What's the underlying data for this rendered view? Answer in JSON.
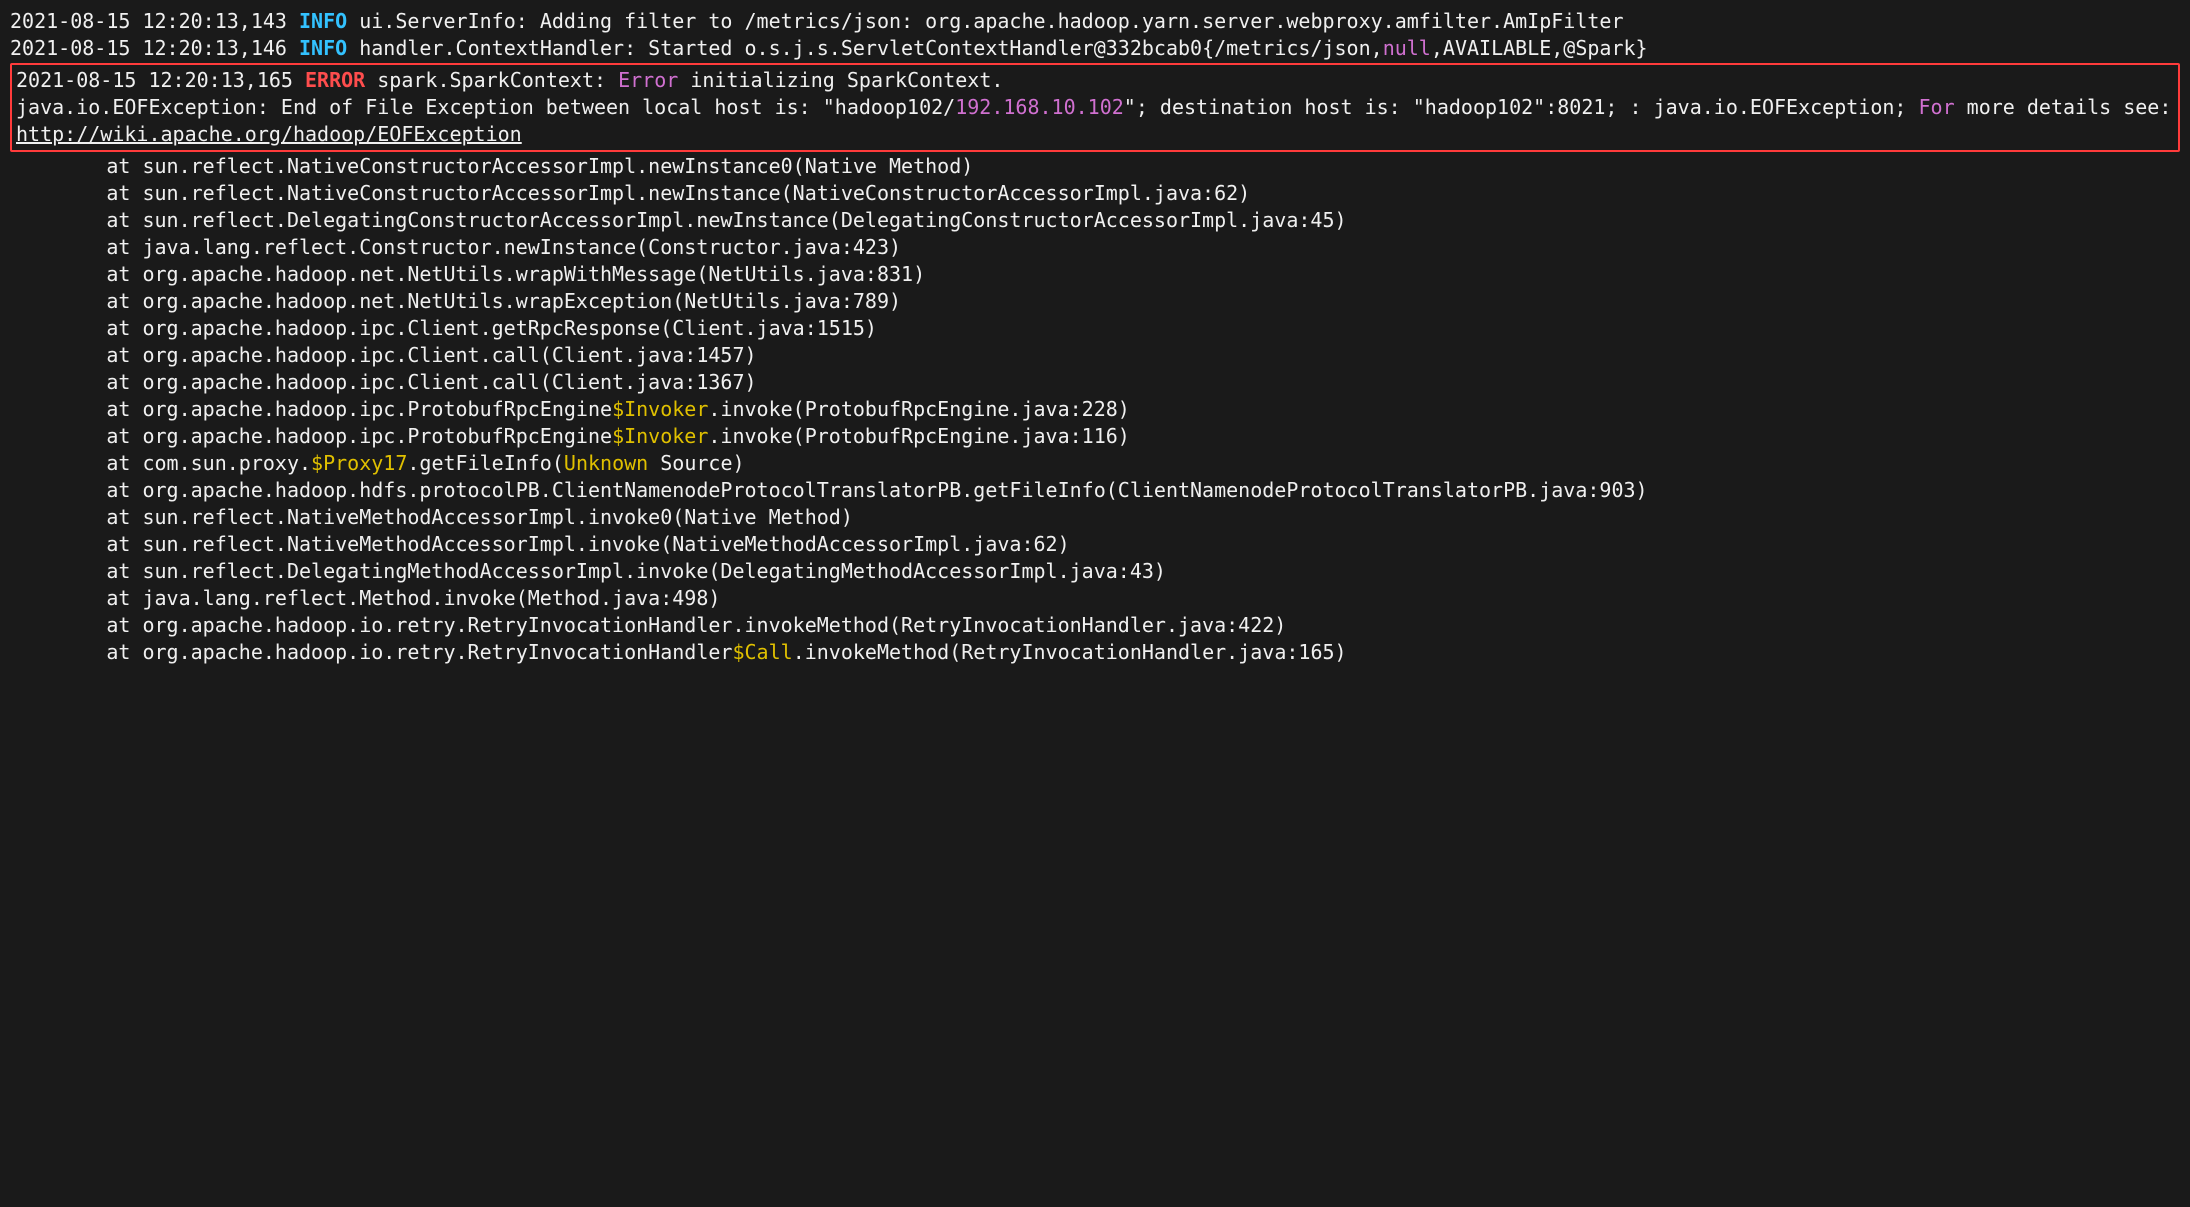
{
  "colors": {
    "info": "#33c2ff",
    "error": "#ff4d4d",
    "pink": "#d070d0",
    "yellow": "#e0c000",
    "hl_border": "#ff3b3b",
    "background": "#1a1a1a",
    "text": "#f0f0f0"
  },
  "log": {
    "l1_ts": "2021-08-15 12:20:13,143 ",
    "l1_level": "INFO",
    "l1_rest": " ui.ServerInfo: Adding filter to /metrics/json: org.apache.hadoop.yarn.server.webproxy.amfilter.AmIpFilter",
    "l2_ts": "2021-08-15 12:20:13,146 ",
    "l2_level": "INFO",
    "l2_a": " handler.ContextHandler: Started o.s.j.s.ServletContextHandler@332bcab0{/metrics/json,",
    "l2_null": "null",
    "l2_b": ",AVAILABLE,@Spark}",
    "hl_ts": "2021-08-15 12:20:13,165 ",
    "hl_level": "ERROR",
    "hl_a": " spark.SparkContext: ",
    "hl_err": "Error",
    "hl_b": " initializing SparkContext.\njava.io.EOFException: End of File Exception between local host is: \"hadoop102/",
    "hl_ip": "192.168.10.102",
    "hl_c": "\"; destination host is: \"hadoop102\":8021; : java.io.EOFException; ",
    "hl_for": "For",
    "hl_d": " more details see:  ",
    "hl_url": "http://wiki.apache.org/hadoop/EOFException",
    "st1": "        at sun.reflect.NativeConstructorAccessorImpl.newInstance0(Native Method)",
    "st2": "        at sun.reflect.NativeConstructorAccessorImpl.newInstance(NativeConstructorAccessorImpl.java:62)",
    "st3": "        at sun.reflect.DelegatingConstructorAccessorImpl.newInstance(DelegatingConstructorAccessorImpl.java:45)",
    "st4": "        at java.lang.reflect.Constructor.newInstance(Constructor.java:423)",
    "st5": "        at org.apache.hadoop.net.NetUtils.wrapWithMessage(NetUtils.java:831)",
    "st6": "        at org.apache.hadoop.net.NetUtils.wrapException(NetUtils.java:789)",
    "st7": "        at org.apache.hadoop.ipc.Client.getRpcResponse(Client.java:1515)",
    "st8": "        at org.apache.hadoop.ipc.Client.call(Client.java:1457)",
    "st9": "        at org.apache.hadoop.ipc.Client.call(Client.java:1367)",
    "st10a": "        at org.apache.hadoop.ipc.ProtobufRpcEngine",
    "st10y": "$Invoker",
    "st10b": ".invoke(ProtobufRpcEngine.java:228)",
    "st11a": "        at org.apache.hadoop.ipc.ProtobufRpcEngine",
    "st11y": "$Invoker",
    "st11b": ".invoke(ProtobufRpcEngine.java:116)",
    "st12a": "        at com.sun.proxy.",
    "st12y1": "$Proxy17",
    "st12b": ".getFileInfo(",
    "st12y2": "Unknown",
    "st12c": " Source)",
    "st13": "        at org.apache.hadoop.hdfs.protocolPB.ClientNamenodeProtocolTranslatorPB.getFileInfo(ClientNamenodeProtocolTranslatorPB.java:903)",
    "st14": "        at sun.reflect.NativeMethodAccessorImpl.invoke0(Native Method)",
    "st15": "        at sun.reflect.NativeMethodAccessorImpl.invoke(NativeMethodAccessorImpl.java:62)",
    "st16": "        at sun.reflect.DelegatingMethodAccessorImpl.invoke(DelegatingMethodAccessorImpl.java:43)",
    "st17": "        at java.lang.reflect.Method.invoke(Method.java:498)",
    "st18": "        at org.apache.hadoop.io.retry.RetryInvocationHandler.invokeMethod(RetryInvocationHandler.java:422)",
    "st19a": "        at org.apache.hadoop.io.retry.RetryInvocationHandler",
    "st19y": "$Call",
    "st19b": ".invokeMethod(RetryInvocationHandler.java:165)"
  }
}
